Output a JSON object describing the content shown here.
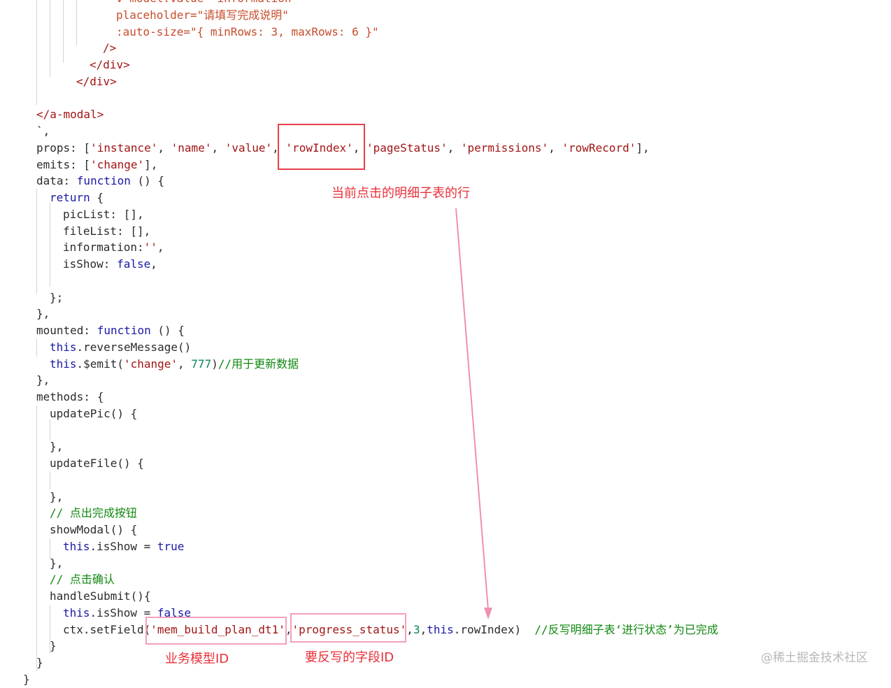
{
  "code_lines": [
    {
      "indent": 6,
      "tokens": [
        {
          "t": "v-model:value=\"information\"",
          "c": "attr"
        }
      ]
    },
    {
      "indent": 6,
      "tokens": [
        {
          "t": "placeholder=\"请填写完成说明\"",
          "c": "attr"
        }
      ]
    },
    {
      "indent": 6,
      "tokens": [
        {
          "t": ":auto-size=\"{ minRows: 3, maxRows: 6 }\"",
          "c": "attr"
        }
      ]
    },
    {
      "indent": 5,
      "tokens": [
        {
          "t": "/>",
          "c": "tag"
        }
      ]
    },
    {
      "indent": 4,
      "tokens": [
        {
          "t": "</div>",
          "c": "tag"
        }
      ]
    },
    {
      "indent": 3,
      "tokens": [
        {
          "t": "</div>",
          "c": "tag"
        }
      ]
    },
    {
      "indent": 0,
      "tokens": []
    },
    {
      "indent": 0,
      "tokens": [
        {
          "t": "</a-modal>",
          "c": "tag"
        }
      ]
    },
    {
      "indent": 0,
      "tokens": [
        {
          "t": "`,",
          "c": "plain"
        }
      ]
    },
    {
      "indent": 0,
      "tokens": [
        {
          "t": "props: [",
          "c": "plain"
        },
        {
          "t": "'instance'",
          "c": "str"
        },
        {
          "t": ", ",
          "c": "plain"
        },
        {
          "t": "'name'",
          "c": "str"
        },
        {
          "t": ", ",
          "c": "plain"
        },
        {
          "t": "'value'",
          "c": "str"
        },
        {
          "t": ", ",
          "c": "plain"
        },
        {
          "t": "'rowIndex'",
          "c": "str"
        },
        {
          "t": ", ",
          "c": "plain"
        },
        {
          "t": "'pageStatus'",
          "c": "str"
        },
        {
          "t": ", ",
          "c": "plain"
        },
        {
          "t": "'permissions'",
          "c": "str"
        },
        {
          "t": ", ",
          "c": "plain"
        },
        {
          "t": "'rowRecord'",
          "c": "str"
        },
        {
          "t": "],",
          "c": "plain"
        }
      ]
    },
    {
      "indent": 0,
      "tokens": [
        {
          "t": "emits: [",
          "c": "plain"
        },
        {
          "t": "'change'",
          "c": "str"
        },
        {
          "t": "],",
          "c": "plain"
        }
      ]
    },
    {
      "indent": 0,
      "tokens": [
        {
          "t": "data: ",
          "c": "plain"
        },
        {
          "t": "function",
          "c": "kw"
        },
        {
          "t": " () {",
          "c": "plain"
        }
      ]
    },
    {
      "indent": 1,
      "tokens": [
        {
          "t": "return",
          "c": "kw"
        },
        {
          "t": " {",
          "c": "plain"
        }
      ]
    },
    {
      "indent": 2,
      "tokens": [
        {
          "t": "picList: [],",
          "c": "plain"
        }
      ]
    },
    {
      "indent": 2,
      "tokens": [
        {
          "t": "fileList: [],",
          "c": "plain"
        }
      ]
    },
    {
      "indent": 2,
      "tokens": [
        {
          "t": "information:",
          "c": "plain"
        },
        {
          "t": "''",
          "c": "str"
        },
        {
          "t": ",",
          "c": "plain"
        }
      ]
    },
    {
      "indent": 2,
      "tokens": [
        {
          "t": "isShow: ",
          "c": "plain"
        },
        {
          "t": "false",
          "c": "kw"
        },
        {
          "t": ",",
          "c": "plain"
        }
      ]
    },
    {
      "indent": 0,
      "tokens": []
    },
    {
      "indent": 1,
      "tokens": [
        {
          "t": "};",
          "c": "plain"
        }
      ]
    },
    {
      "indent": 0,
      "tokens": [
        {
          "t": "},",
          "c": "plain"
        }
      ]
    },
    {
      "indent": 0,
      "tokens": [
        {
          "t": "mounted: ",
          "c": "plain"
        },
        {
          "t": "function",
          "c": "kw"
        },
        {
          "t": " () {",
          "c": "plain"
        }
      ]
    },
    {
      "indent": 1,
      "tokens": [
        {
          "t": "this",
          "c": "kw"
        },
        {
          "t": ".reverseMessage()",
          "c": "plain"
        }
      ]
    },
    {
      "indent": 1,
      "tokens": [
        {
          "t": "this",
          "c": "kw"
        },
        {
          "t": ".$emit(",
          "c": "plain"
        },
        {
          "t": "'change'",
          "c": "str"
        },
        {
          "t": ", ",
          "c": "plain"
        },
        {
          "t": "777",
          "c": "num"
        },
        {
          "t": ")",
          "c": "plain"
        },
        {
          "t": "//用于更新数据",
          "c": "cmt"
        }
      ]
    },
    {
      "indent": 0,
      "tokens": [
        {
          "t": "},",
          "c": "plain"
        }
      ]
    },
    {
      "indent": 0,
      "tokens": [
        {
          "t": "methods: {",
          "c": "plain"
        }
      ]
    },
    {
      "indent": 1,
      "tokens": [
        {
          "t": "updatePic() {",
          "c": "plain"
        }
      ]
    },
    {
      "indent": 0,
      "tokens": []
    },
    {
      "indent": 1,
      "tokens": [
        {
          "t": "},",
          "c": "plain"
        }
      ]
    },
    {
      "indent": 1,
      "tokens": [
        {
          "t": "updateFile() {",
          "c": "plain"
        }
      ]
    },
    {
      "indent": 0,
      "tokens": []
    },
    {
      "indent": 1,
      "tokens": [
        {
          "t": "},",
          "c": "plain"
        }
      ]
    },
    {
      "indent": 1,
      "tokens": [
        {
          "t": "// 点出完成按钮",
          "c": "cmt"
        }
      ]
    },
    {
      "indent": 1,
      "tokens": [
        {
          "t": "showModal() {",
          "c": "plain"
        }
      ]
    },
    {
      "indent": 2,
      "tokens": [
        {
          "t": "this",
          "c": "kw"
        },
        {
          "t": ".isShow = ",
          "c": "plain"
        },
        {
          "t": "true",
          "c": "kw"
        }
      ]
    },
    {
      "indent": 1,
      "tokens": [
        {
          "t": "},",
          "c": "plain"
        }
      ]
    },
    {
      "indent": 1,
      "tokens": [
        {
          "t": "// 点击确认",
          "c": "cmt"
        }
      ]
    },
    {
      "indent": 1,
      "tokens": [
        {
          "t": "handleSubmit(){",
          "c": "plain"
        }
      ]
    },
    {
      "indent": 2,
      "tokens": [
        {
          "t": "this",
          "c": "kw"
        },
        {
          "t": ".isShow = ",
          "c": "plain"
        },
        {
          "t": "false",
          "c": "kw"
        }
      ]
    },
    {
      "indent": 2,
      "tokens": [
        {
          "t": "ctx.setField(",
          "c": "plain"
        },
        {
          "t": "'mem_build_plan_dt1'",
          "c": "str"
        },
        {
          "t": ",",
          "c": "plain"
        },
        {
          "t": "'progress_status'",
          "c": "str"
        },
        {
          "t": ",",
          "c": "plain"
        },
        {
          "t": "3",
          "c": "num"
        },
        {
          "t": ",",
          "c": "plain"
        },
        {
          "t": "this",
          "c": "kw"
        },
        {
          "t": ".rowIndex)  ",
          "c": "plain"
        },
        {
          "t": "//反写明细子表‘进行状态’为已完成",
          "c": "cmt"
        }
      ]
    },
    {
      "indent": 1,
      "tokens": [
        {
          "t": "}",
          "c": "plain"
        }
      ]
    },
    {
      "indent": 0,
      "tokens": [
        {
          "t": "}",
          "c": "plain"
        }
      ]
    },
    {
      "indent": -1,
      "tokens": [
        {
          "t": "}",
          "c": "plain"
        }
      ]
    }
  ],
  "annotations": {
    "row_index_note": "当前点击的明细子表的行",
    "model_id_note": "业务模型ID",
    "field_id_note": "要反写的字段ID"
  },
  "watermark": "@稀土掘金技术社区",
  "colors": {
    "tag": "#a31515",
    "attr": "#c74c2c",
    "string": "#a31515",
    "keyword": "#1a1aa6",
    "number": "#098658",
    "comment": "#118811",
    "highlight_red": "#e8404a",
    "highlight_pink": "#f3a0b8",
    "arrow": "#f090b0"
  }
}
